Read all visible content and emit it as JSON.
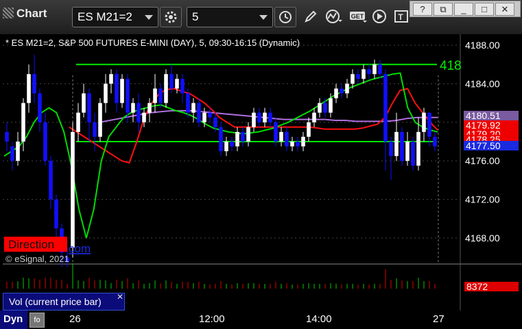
{
  "app": {
    "title": "Chart"
  },
  "toolbar": {
    "symbol": "ES M21=2",
    "interval": "5",
    "icons": [
      "gear-icon",
      "clock-icon",
      "pencil-icon",
      "study-icon",
      "get-icon",
      "play-icon",
      "text-icon"
    ]
  },
  "window_buttons": [
    "?",
    "⧉",
    "_",
    "□",
    "✕"
  ],
  "chart": {
    "header": "* ES M21=2, S&P 500 FUTURES E-MINI (DAY), 5, 09:30-16:15 (Dynamic)",
    "copyright": "© eSignal, 2021",
    "watermark_badge": "Direction",
    "watermark_link": "com",
    "line_label": "418",
    "colors": {
      "up": "#ffffff",
      "down": "#1010ff",
      "level": "#00ee00",
      "red_ma": "#ff1010",
      "green_ma": "#00dd00",
      "purple_ma": "#b070e0",
      "badge_red": "#ff0000",
      "badge_blue": "#1a2adf"
    }
  },
  "price_badges": [
    {
      "text": "4180.51",
      "bg": "#7a5aa0"
    },
    {
      "text": "4179.92",
      "bg": "#ee0000"
    },
    {
      "text": "4179.20",
      "bg": "#ee0000"
    },
    {
      "text": "4178.25",
      "bg": "#ee0000"
    },
    {
      "text": "4177.50",
      "bg": "#1a2adf"
    }
  ],
  "volume": {
    "label": "Vol (current price bar)",
    "close_label": "✕",
    "value": "8372"
  },
  "footer": {
    "dyn_label": "Dyn",
    "dyn_icon": "fo"
  },
  "chart_data": {
    "type": "candlestick",
    "ylim": [
      4165,
      4190
    ],
    "yticks": [
      "4188.00",
      "4184.00",
      "4180.00",
      "4176.00",
      "4172.00",
      "4168.00"
    ],
    "xticks": [
      "26",
      "12:00",
      "14:00",
      "27"
    ],
    "horizontal_levels": [
      4186.0,
      4178.0
    ],
    "candles": [
      [
        4179,
        4178,
        4177,
        4180
      ],
      [
        4177.5,
        4176,
        4175,
        4178
      ],
      [
        4176,
        4178,
        4175.5,
        4179
      ],
      [
        4178,
        4182,
        4177,
        4182.5
      ],
      [
        4182,
        4185,
        4181,
        4186
      ],
      [
        4185,
        4183,
        4182,
        4187
      ],
      [
        4183,
        4180,
        4179,
        4183.5
      ],
      [
        4180,
        4176,
        4175.5,
        4181
      ],
      [
        4176,
        4172,
        4171,
        4176.5
      ],
      [
        4172,
        4169,
        4168,
        4172.5
      ],
      [
        4169,
        4166.5,
        4165,
        4169.5
      ],
      [
        4166,
        4165.5,
        4165,
        4167
      ],
      [
        4167,
        4179,
        4166,
        4180
      ],
      [
        4179,
        4181,
        4178,
        4182
      ],
      [
        4181,
        4183,
        4180.5,
        4184
      ],
      [
        4183,
        4180,
        4178,
        4183.5
      ],
      [
        4180,
        4178.5,
        4177,
        4181
      ],
      [
        4178.5,
        4182,
        4178,
        4182.5
      ],
      [
        4182,
        4184,
        4181,
        4185
      ],
      [
        4184,
        4185,
        4183,
        4185.5
      ],
      [
        4185,
        4182,
        4181,
        4185.5
      ],
      [
        4182,
        4184.5,
        4181.5,
        4185
      ],
      [
        4184.5,
        4181,
        4180,
        4185
      ],
      [
        4181,
        4182,
        4180,
        4182.5
      ],
      [
        4182,
        4180,
        4179,
        4183
      ],
      [
        4180,
        4181,
        4179.5,
        4181.5
      ],
      [
        4181,
        4182,
        4180,
        4182.5
      ],
      [
        4182,
        4183.5,
        4181,
        4185
      ],
      [
        4183.5,
        4182,
        4181.5,
        4184
      ],
      [
        4182,
        4185,
        4181.5,
        4185.5
      ],
      [
        4185,
        4183.5,
        4183,
        4186
      ],
      [
        4183.5,
        4184.5,
        4183,
        4185
      ],
      [
        4184.5,
        4183,
        4182,
        4185
      ],
      [
        4183,
        4181,
        4180.5,
        4183.5
      ],
      [
        4181,
        4182,
        4180,
        4182.5
      ],
      [
        4182,
        4180,
        4179.5,
        4182.5
      ],
      [
        4180,
        4181,
        4179.5,
        4181.5
      ],
      [
        4181,
        4180.5,
        4180,
        4181.5
      ],
      [
        4180.5,
        4179.5,
        4179,
        4181
      ],
      [
        4179.5,
        4177,
        4176.5,
        4180
      ],
      [
        4177,
        4178,
        4176.5,
        4178.5
      ],
      [
        4178,
        4177.5,
        4177,
        4178.5
      ],
      [
        4177.5,
        4179,
        4177,
        4179.5
      ],
      [
        4179,
        4178,
        4177.5,
        4179.5
      ],
      [
        4178,
        4179.5,
        4177.5,
        4180
      ],
      [
        4179.5,
        4181,
        4179,
        4181.5
      ],
      [
        4181,
        4180,
        4179.5,
        4181.5
      ],
      [
        4180,
        4181,
        4179.5,
        4181.5
      ],
      [
        4181,
        4180,
        4179.5,
        4181.5
      ],
      [
        4180,
        4178,
        4177.5,
        4180.5
      ],
      [
        4178,
        4179,
        4177.5,
        4179.5
      ],
      [
        4179,
        4177.5,
        4177,
        4179.5
      ],
      [
        4177.5,
        4178,
        4177,
        4178.5
      ],
      [
        4178,
        4177.5,
        4177,
        4178.5
      ],
      [
        4177.5,
        4178.5,
        4177,
        4179
      ],
      [
        4178.5,
        4180,
        4178,
        4180.5
      ],
      [
        4180,
        4181,
        4179.5,
        4181.5
      ],
      [
        4181,
        4182,
        4180.5,
        4182.5
      ],
      [
        4182,
        4181,
        4180.5,
        4182.5
      ],
      [
        4181,
        4182.5,
        4180.5,
        4183
      ],
      [
        4182.5,
        4183.5,
        4182,
        4184
      ],
      [
        4183.5,
        4183,
        4182.5,
        4184
      ],
      [
        4183,
        4184,
        4182.5,
        4184.5
      ],
      [
        4184,
        4185,
        4183.5,
        4185.5
      ],
      [
        4185,
        4184.5,
        4184,
        4185.5
      ],
      [
        4184.5,
        4185.5,
        4184,
        4186
      ],
      [
        4185.5,
        4185,
        4184.5,
        4186
      ],
      [
        4185,
        4186,
        4184.5,
        4186.5
      ],
      [
        4186,
        4185,
        4184.5,
        4186.5
      ],
      [
        4185,
        4178,
        4175,
        4185.5
      ],
      [
        4178,
        4176.5,
        4174,
        4178.5
      ],
      [
        4176.5,
        4179,
        4176,
        4181
      ],
      [
        4179,
        4176,
        4175.5,
        4179.5
      ],
      [
        4176,
        4178,
        4175.5,
        4179
      ],
      [
        4178,
        4175.5,
        4175,
        4178.5
      ],
      [
        4175.5,
        4179,
        4175,
        4180.5
      ],
      [
        4179,
        4181,
        4178,
        4181.5
      ],
      [
        4181,
        4178.5,
        4177.5,
        4181
      ],
      [
        4178.5,
        4177.5,
        4177,
        4179
      ]
    ],
    "red_ma": [
      4179.5,
      4179,
      4178.5,
      4178,
      4177.5,
      4177,
      4176.5,
      4176,
      4175.8,
      4178,
      4180.5,
      4182,
      4183,
      4183.4,
      4183.5,
      4183.2,
      4183,
      4182.5,
      4182,
      4181.3,
      4180.5,
      4180,
      4179.5,
      4179.5,
      4179.5,
      4179.5,
      4179.5,
      4179.5,
      4179.5,
      4179.5,
      4179.5,
      4179.5,
      4179.5,
      4179.4,
      4179.3,
      4179.3,
      4179.3,
      4179.3,
      4179.3,
      4179.4,
      4179.6,
      4179.8,
      4180.5,
      4182,
      4183.3,
      4183.5,
      4182,
      4181,
      4180,
      4179.2
    ],
    "green_ma": [
      4176.5,
      4177,
      4177.5,
      4178.5,
      4180,
      4181,
      4181.5,
      4181,
      4179,
      4175.5,
      4171,
      4168,
      4171,
      4176,
      4178.5,
      4179.5,
      4180.5,
      4181,
      4181.3,
      4181.5,
      4181.7,
      4181.8,
      4181.5,
      4181.2,
      4181,
      4180.7,
      4180.3,
      4179.8,
      4179.4,
      4179.2,
      4179,
      4178.9,
      4178.8,
      4178.9,
      4179,
      4179.2,
      4179.4,
      4179.7,
      4180,
      4180.4,
      4180.8,
      4181.2,
      4181.7,
      4182.2,
      4182.7,
      4183.1,
      4183.5,
      4183.8,
      4184.1,
      4184.4,
      4184.6,
      4184.8,
      4185,
      4185.1,
      4181.5,
      4180,
      4179.5,
      4179.2,
      4179
    ],
    "purple_ma": [
      4180,
      4180.2,
      4180.4,
      4180.6,
      4180.8,
      4181,
      4181.1,
      4181.2,
      4181.2,
      4181.2,
      4181.1,
      4181,
      4180.9,
      4180.8,
      4180.7,
      4180.6,
      4180.5,
      4180.4,
      4180.3,
      4180.3,
      4180.3,
      4180.3,
      4180.3,
      4180.2,
      4180.2,
      4180.1,
      4180.1,
      4180.1,
      4180.1,
      4180.2,
      4180.4,
      4180.5,
      4180.5,
      4180.5
    ]
  }
}
